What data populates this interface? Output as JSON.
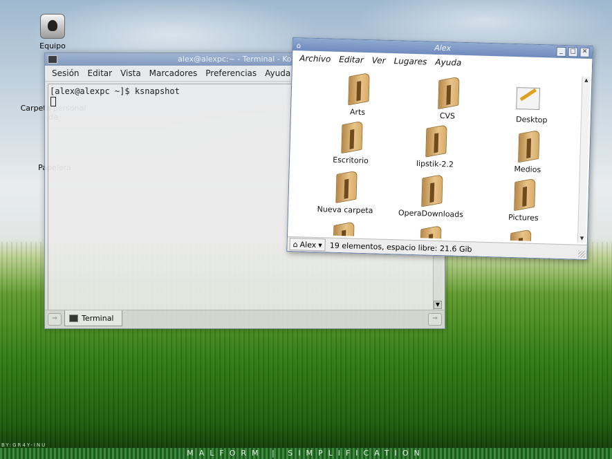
{
  "desktop": {
    "credit": "BY:GR4Y-INU",
    "banner": "MALFORM | SIMPLIFICATION",
    "icons": [
      {
        "label": "Equipo"
      },
      {
        "label": "Carpeta personal de"
      },
      {
        "label": "Papelera"
      }
    ]
  },
  "konsole": {
    "title": "alex@alexpc:~ - Terminal - Konsole",
    "menu": [
      "Sesión",
      "Editar",
      "Vista",
      "Marcadores",
      "Preferencias",
      "Ayuda"
    ],
    "prompt_line": "[alex@alexpc ~]$ ksnapshot",
    "tab_label": "Terminal"
  },
  "file_manager": {
    "title": "Alex",
    "menu": [
      "Archivo",
      "Editar",
      "Ver",
      "Lugares",
      "Ayuda"
    ],
    "items": [
      "Arts",
      "CVS",
      "Desktop",
      "Escritorio",
      "lipstik-2.2",
      "Medios",
      "Nueva carpeta",
      "OperaDownloads",
      "Pictures"
    ],
    "location": "Alex",
    "status": "19 elementos, espacio libre: 21.6 Gib"
  },
  "colors": {
    "titlebar": "#7f98bf",
    "folder": "#e8c489"
  }
}
